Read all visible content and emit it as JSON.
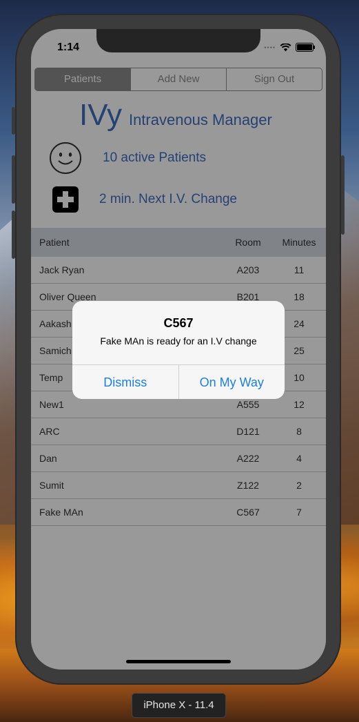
{
  "simulator": {
    "device_label": "iPhone X - 11.4"
  },
  "status_bar": {
    "time": "1:14",
    "signal": "••••"
  },
  "tabs": [
    {
      "label": "Patients",
      "active": true
    },
    {
      "label": "Add New",
      "active": false
    },
    {
      "label": "Sign Out",
      "active": false
    }
  ],
  "brand": {
    "name": "IVy",
    "subtitle": "Intravenous Manager"
  },
  "stats": {
    "active_patients": "10 active Patients",
    "next_change": "2 min. Next I.V. Change"
  },
  "table": {
    "columns": [
      "Patient",
      "Room",
      "Minutes"
    ],
    "rows": [
      {
        "name": "Jack Ryan",
        "room": "A203",
        "minutes": "11"
      },
      {
        "name": "Oliver Queen",
        "room": "B201",
        "minutes": "18"
      },
      {
        "name": "Aakash",
        "room": "",
        "minutes": "24"
      },
      {
        "name": "Samich",
        "room": "",
        "minutes": "25"
      },
      {
        "name": "Temp",
        "room": "",
        "minutes": "10"
      },
      {
        "name": "New1",
        "room": "A555",
        "minutes": "12"
      },
      {
        "name": "ARC",
        "room": "D121",
        "minutes": "8"
      },
      {
        "name": "Dan",
        "room": "A222",
        "minutes": "4"
      },
      {
        "name": "Sumit",
        "room": "Z122",
        "minutes": "2"
      },
      {
        "name": "Fake MAn",
        "room": "C567",
        "minutes": "7"
      }
    ]
  },
  "alert": {
    "title": "C567",
    "message": "Fake MAn is ready for an I.V change",
    "dismiss_label": "Dismiss",
    "confirm_label": "On My Way"
  },
  "colors": {
    "accent": "#3d6ec0",
    "alert_button": "#1a7fe0"
  }
}
